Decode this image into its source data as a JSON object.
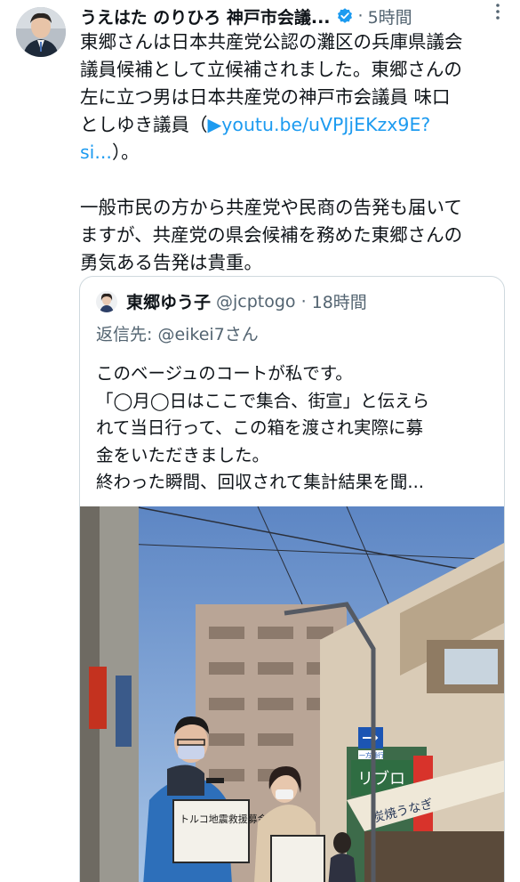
{
  "tweet": {
    "author_name": "うえはた のりひろ 神戸市会議...",
    "separator": "·",
    "time": "5時間",
    "more_icon": "more-icon",
    "verified_icon": "verified-badge-icon",
    "lines": [
      "東郷さんは日本共産党公認の灘区の兵庫県議会",
      "議員候補として立候補されました。東郷さんの",
      "左に立つ男は日本共産党の神戸市会議員 味口",
      "としゆき議員（"
    ],
    "link_text": "▶youtu.be/uVPJjEKzx9E?",
    "link_text_2": "si...",
    "after_link": "）。",
    "paragraph2": [
      "一般市民の方から共産党や民商の告発も届いて",
      "ますが、共産党の県会候補を務めた東郷さんの",
      "勇気ある告発は貴重。"
    ]
  },
  "quote": {
    "name": "東郷ゆう子",
    "handle": "@jcptogo",
    "separator": "·",
    "time": "18時間",
    "reply_to": "返信先: @eikei7さん",
    "lines": [
      "このベージュのコートが私です。",
      "「◯月◯日はここで集合、街宣」と伝えら",
      "れて当日行って、この箱を渡され実際に募",
      "金をいただきました。",
      "終わった瞬間、回収されて集計結果を聞..."
    ],
    "photo": {
      "box_text": "トルコ地震救援募金",
      "sign_text": "リブロ",
      "shop_text": "炭焼うなぎ",
      "road_sign_text": "一方通行"
    }
  },
  "colors": {
    "link": "#1d9bf0",
    "secondary_text": "#536471",
    "border": "#cfd9de",
    "verified": "#1d9bf0"
  }
}
